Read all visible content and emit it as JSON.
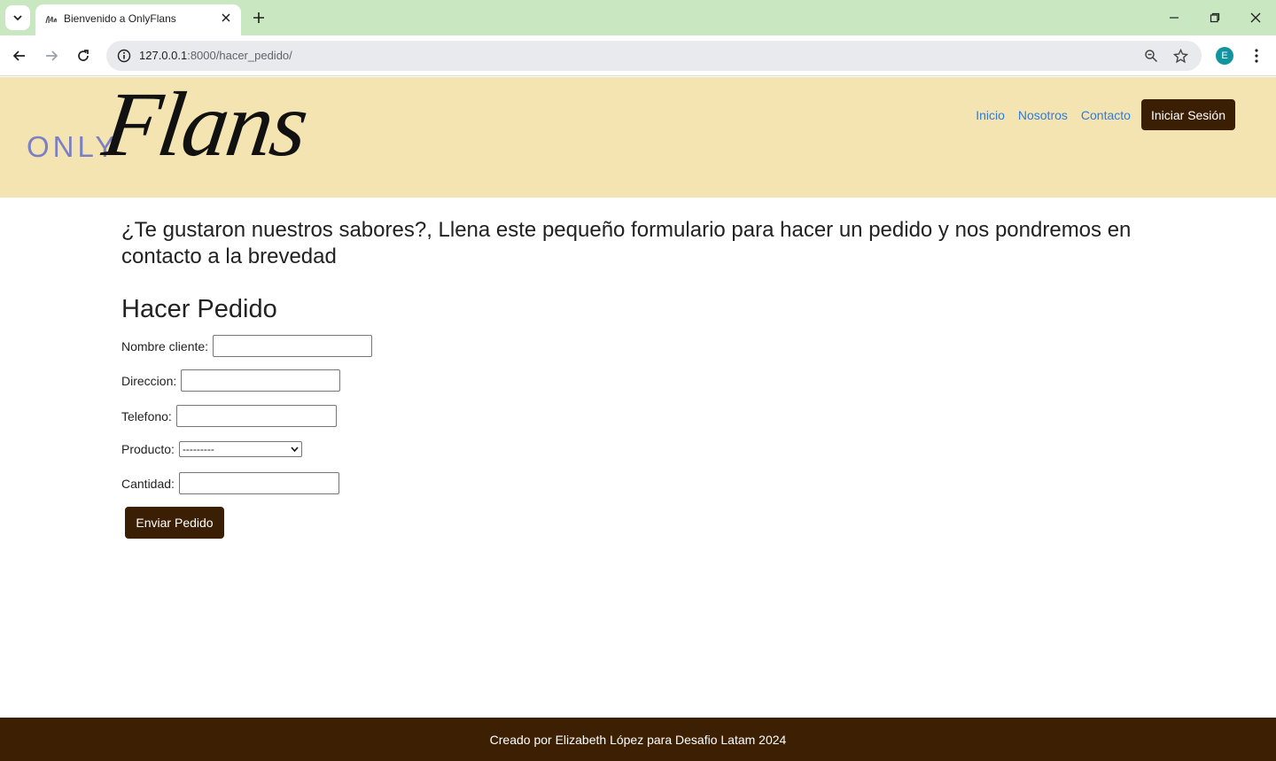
{
  "browser": {
    "tab_title": "Bienvenido a OnlyFlans",
    "url_host": "127.0.0.1",
    "url_path": ":8000/hacer_pedido/",
    "profile_initial": "E"
  },
  "header": {
    "logo_only": "ONLY",
    "logo_flans": "Flans",
    "nav": [
      "Inicio",
      "Nosotros",
      "Contacto"
    ],
    "login_label": "Iniciar Sesión"
  },
  "main": {
    "intro": "¿Te gustaron nuestros sabores?, Llena este pequeño formulario para hacer un pedido y nos pondremos en contacto a la brevedad",
    "form_title": "Hacer Pedido",
    "fields": {
      "nombre": {
        "label": "Nombre cliente:",
        "value": ""
      },
      "direccion": {
        "label": "Direccion:",
        "value": ""
      },
      "telefono": {
        "label": "Telefono:",
        "value": ""
      },
      "producto": {
        "label": "Producto:",
        "selected": "---------"
      },
      "cantidad": {
        "label": "Cantidad:",
        "value": ""
      }
    },
    "submit_label": "Enviar Pedido"
  },
  "footer": {
    "text": "Creado por Elizabeth López para Desafio Latam 2024"
  },
  "colors": {
    "tabbar": "#c9e8c2",
    "header_bg": "#f3e4b1",
    "brand_dark": "#3b1f05",
    "link": "#2c7be5",
    "logo_only": "#7b7fc4"
  }
}
